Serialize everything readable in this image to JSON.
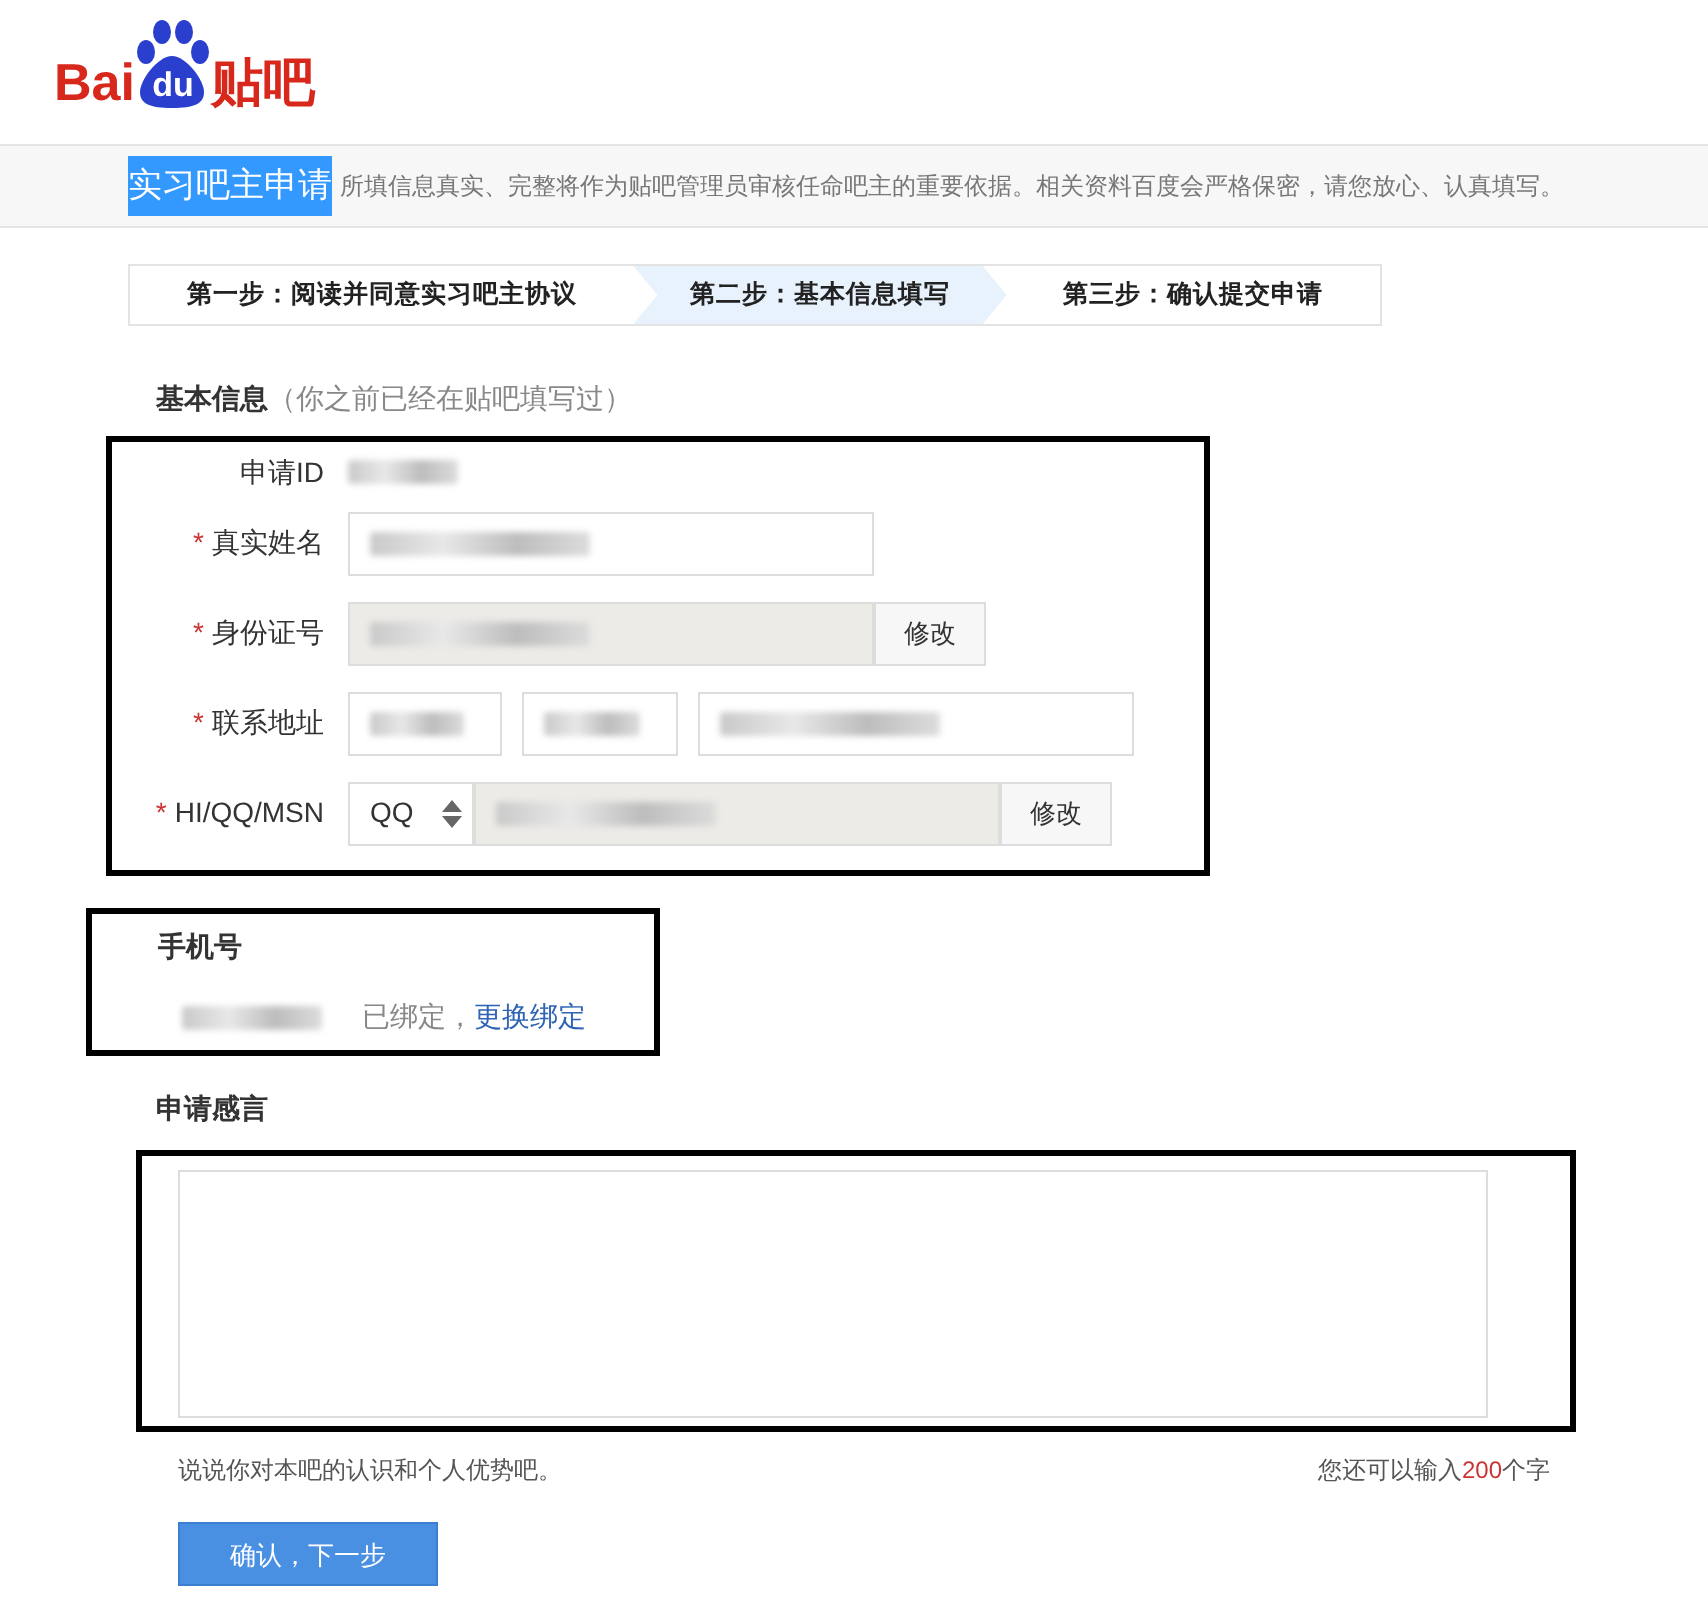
{
  "logo": {
    "left": "Bai",
    "paw": "du",
    "right": "贴吧"
  },
  "header": {
    "title": "实习吧主申请",
    "note": "所填信息真实、完整将作为贴吧管理员审核任命吧主的重要依据。相关资料百度会严格保密，请您放心、认真填写。"
  },
  "steps": [
    {
      "label": "第一步：阅读并同意实习吧主协议",
      "selected": false
    },
    {
      "label": "第二步：基本信息填写",
      "selected": true
    },
    {
      "label": "第三步：确认提交申请",
      "selected": false
    }
  ],
  "basic": {
    "heading": "基本信息",
    "note": "（你之前已经在贴吧填写过）",
    "rows": [
      {
        "kind": "text",
        "label": "申请ID",
        "blurred": true
      },
      {
        "kind": "input",
        "mark": "*",
        "label": "真实姓名",
        "fields": [
          {
            "disabled": false,
            "blurred": true
          }
        ]
      },
      {
        "kind": "input",
        "mark": "*",
        "label": "身份证号",
        "fields": [
          {
            "disabled": true,
            "blurred": true
          }
        ],
        "button": "修改"
      },
      {
        "kind": "input",
        "mark": "*",
        "label": "联系地址",
        "fields": [
          {
            "disabled": false,
            "blurred": true
          },
          {
            "disabled": false,
            "blurred": true
          },
          {
            "disabled": false,
            "blurred": true
          }
        ]
      },
      {
        "kind": "select",
        "mark": "*",
        "label": "HI/QQ/MSN",
        "select": "QQ",
        "fields": [
          {
            "disabled": true,
            "blurred": true
          }
        ],
        "button": "修改"
      }
    ]
  },
  "phone": {
    "heading": "手机号",
    "blurred": true,
    "status": "已绑定，",
    "link": "更换绑定"
  },
  "message": {
    "heading": "申请感言",
    "hint": "说说你对本吧的认识和个人优势吧。",
    "counter_prefix": "您还可以输入",
    "counter_count": "200",
    "counter_suffix": "个字"
  },
  "submit": "确认，下一步"
}
